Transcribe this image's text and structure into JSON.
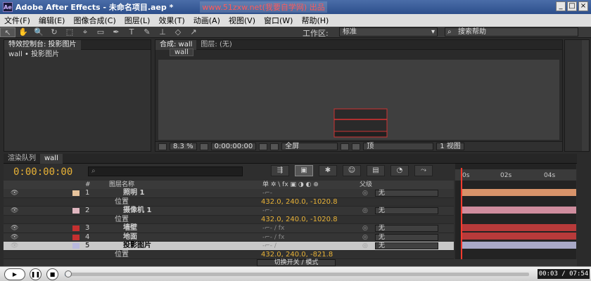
{
  "window": {
    "title": "Adobe After Effects - 未命名项目.aep *",
    "app_icon": "Ae",
    "watermark": "www.51zxw.net(我要自学网) 出品",
    "buttons": [
      "_",
      "□",
      "×"
    ]
  },
  "menu": [
    "文件(F)",
    "编辑(E)",
    "图像合成(C)",
    "图层(L)",
    "效果(T)",
    "动画(A)",
    "视图(V)",
    "窗口(W)",
    "帮助(H)"
  ],
  "toolbar": {
    "tools": [
      "↖",
      "✋",
      "🔍",
      "↻",
      "⬚",
      "⌖",
      "▭",
      "✒",
      "T",
      "✎",
      "⊥",
      "◇",
      "↗"
    ],
    "workspace_label": "工作区:",
    "workspace_value": "标准",
    "help_placeholder": "搜索帮助"
  },
  "effect_controls": {
    "tab": "特效控制台: 投影图片",
    "subtitle": "wall • 投影图片"
  },
  "composition": {
    "tab": "合成: wall",
    "layer_tab": "图层: (无)",
    "chip": "wall",
    "zoom": "8.3 %",
    "timecode": "0:00:00:00",
    "resolution": "全屏",
    "view": "顶",
    "views": "1 视图"
  },
  "timeline": {
    "tabs": [
      "渲染队列",
      "wall"
    ],
    "timecode": "0:00:00:00",
    "search_placeholder": "",
    "column_headers": {
      "num": "#",
      "name": "图层名称",
      "switches": "单 ✲ \\ fx ▣ ◑ ◐ ⊕",
      "parent": "父级"
    },
    "ruler": [
      "0s",
      "02s",
      "04s"
    ],
    "toggle_label": "切换开关 / 模式",
    "rows": [
      {
        "kind": "layer",
        "num": "1",
        "name": "照明 1",
        "color": "#e7c39c",
        "parent": "无"
      },
      {
        "kind": "prop",
        "name": "位置",
        "value": "432.0, 240.0, -1020.8"
      },
      {
        "kind": "layer",
        "num": "2",
        "name": "摄像机 1",
        "color": "#e0b7c0",
        "parent": "无"
      },
      {
        "kind": "prop",
        "name": "位置",
        "value": "432.0, 240.0, -1020.8"
      },
      {
        "kind": "layer",
        "num": "3",
        "name": "墙壁",
        "color": "#c53030",
        "parent": "无"
      },
      {
        "kind": "layer",
        "num": "4",
        "name": "地面",
        "color": "#c53030",
        "parent": "无"
      },
      {
        "kind": "layer-selected",
        "num": "5",
        "name": "投影图片",
        "color": "#b9b9de",
        "parent": "无"
      },
      {
        "kind": "prop",
        "name": "位置",
        "value": "432.0, 240.0, -821.8"
      }
    ],
    "bar_colors": [
      "#d8936a",
      "#cf8d9e",
      "#b83a3a",
      "#b83a3a",
      "#a9a9c7"
    ]
  },
  "player": {
    "time": "00:03 / 07:54",
    "progress": 0.006
  }
}
